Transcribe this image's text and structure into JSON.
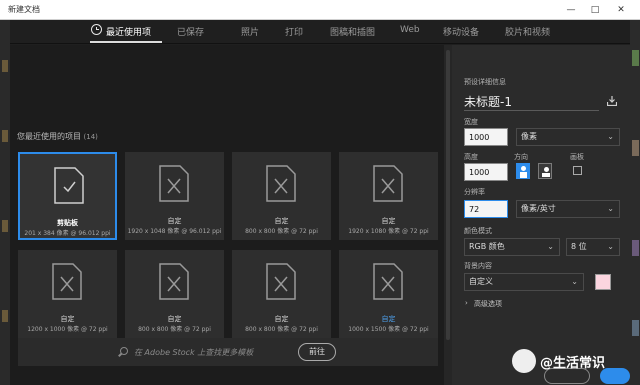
{
  "window": {
    "title": "新建文档",
    "controls": [
      "—",
      "□",
      "✕"
    ]
  },
  "tabs": [
    {
      "label": "最近使用项",
      "active": true
    },
    {
      "label": "已保存"
    },
    {
      "label": "照片"
    },
    {
      "label": "打印"
    },
    {
      "label": "图稿和插图"
    },
    {
      "label": "Web"
    },
    {
      "label": "移动设备"
    },
    {
      "label": "胶片和视频"
    }
  ],
  "recent": {
    "title": "您最近使用的项目",
    "count": "(14)",
    "cards": [
      {
        "name": "剪贴板",
        "sub": "201 x 384 像素 @ 96.012 ppi",
        "icon": "clipboard-doc-icon",
        "selected": true
      },
      {
        "name": "自定",
        "sub": "1920 x 1048 像素 @ 96.012 ppi",
        "icon": "custom-doc-icon"
      },
      {
        "name": "自定",
        "sub": "800 x 800 像素 @ 72 ppi",
        "icon": "custom-doc-icon"
      },
      {
        "name": "自定",
        "sub": "1920 x 1080 像素 @ 72 ppi",
        "icon": "custom-doc-icon"
      },
      {
        "name": "自定",
        "sub": "1200 x 1000 像素 @ 72 ppi",
        "icon": "custom-doc-icon"
      },
      {
        "name": "自定",
        "sub": "800 x 800 像素 @ 72 ppi",
        "icon": "custom-doc-icon"
      },
      {
        "name": "自定",
        "sub": "800 x 800 像素 @ 72 ppi",
        "icon": "custom-doc-icon"
      },
      {
        "name": "自定",
        "sub": "1000 x 1500 像素 @ 72 ppi",
        "icon": "custom-doc-icon",
        "highlight": true
      }
    ]
  },
  "stock": {
    "placeholder": "在 Adobe Stock 上查找更多模板",
    "go_label": "前往"
  },
  "details": {
    "section_title": "预设详细信息",
    "doc_name": "未标题-1",
    "width_label": "宽度",
    "width_value": "1000",
    "width_unit": "像素",
    "height_label": "高度",
    "height_value": "1000",
    "orientation_label": "方向",
    "artboard_label": "画板",
    "resolution_label": "分辨率",
    "resolution_value": "72",
    "resolution_unit": "像素/英寸",
    "color_mode_label": "颜色模式",
    "color_mode_value": "RGB 颜色",
    "bit_depth_value": "8 位",
    "background_label": "背景内容",
    "background_value": "自定义",
    "background_color": "#fbd5df",
    "advanced_label": "高级选项"
  },
  "watermark": {
    "text": "@生活常识"
  },
  "colors": {
    "accent": "#2d8ceb",
    "bg": "#1f1f1f",
    "panel": "#2b2b2b"
  }
}
